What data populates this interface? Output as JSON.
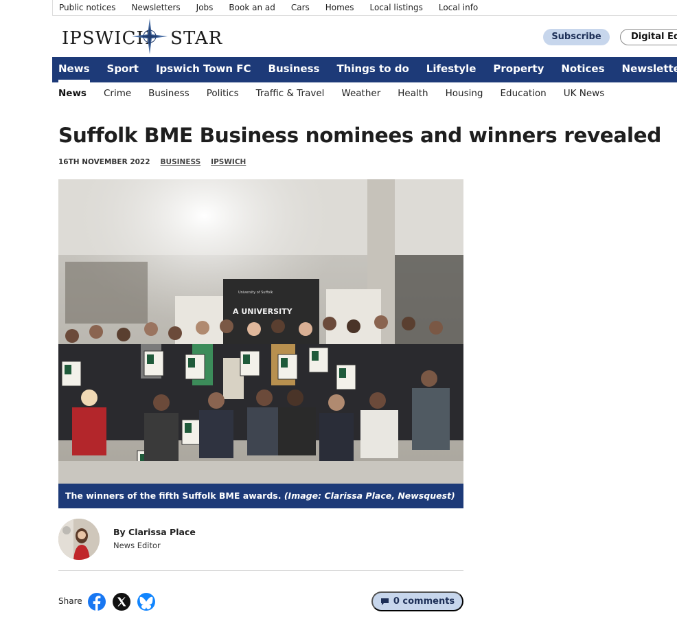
{
  "utility_links": [
    "Public notices",
    "Newsletters",
    "Jobs",
    "Book an ad",
    "Cars",
    "Homes",
    "Local listings",
    "Local info"
  ],
  "logo": {
    "text_left": "IPSWICH",
    "text_right": "STAR"
  },
  "header": {
    "subscribe_label": "Subscribe",
    "digital_label": "Digital Ed"
  },
  "main_nav": [
    "News",
    "Sport",
    "Ipswich Town FC",
    "Business",
    "Things to do",
    "Lifestyle",
    "Property",
    "Notices",
    "Newsletters"
  ],
  "sub_nav": [
    "News",
    "Crime",
    "Business",
    "Politics",
    "Traffic & Travel",
    "Weather",
    "Health",
    "Housing",
    "Education",
    "UK News"
  ],
  "article": {
    "headline": "Suffolk BME Business nominees and winners revealed",
    "date": "16TH NOVEMBER 2022",
    "tags": [
      "BUSINESS",
      "IPSWICH"
    ],
    "caption_text": "The winners of the fifth Suffolk BME awards.",
    "caption_credit": "(Image: Clarissa Place, Newsquest)",
    "banner_text": "A UNIVERSITY",
    "banner_logo": "University of Suffolk"
  },
  "author": {
    "name": "By Clarissa Place",
    "role": "News Editor"
  },
  "share": {
    "label": "Share",
    "buttons": [
      "facebook-icon",
      "x-icon",
      "bluesky-icon"
    ]
  },
  "comments": {
    "label": "0 comments"
  },
  "colors": {
    "brand_blue": "#1d3a78",
    "pill_blue": "#c7d6ec",
    "facebook": "#1877f2",
    "bluesky": "#1185fe"
  }
}
